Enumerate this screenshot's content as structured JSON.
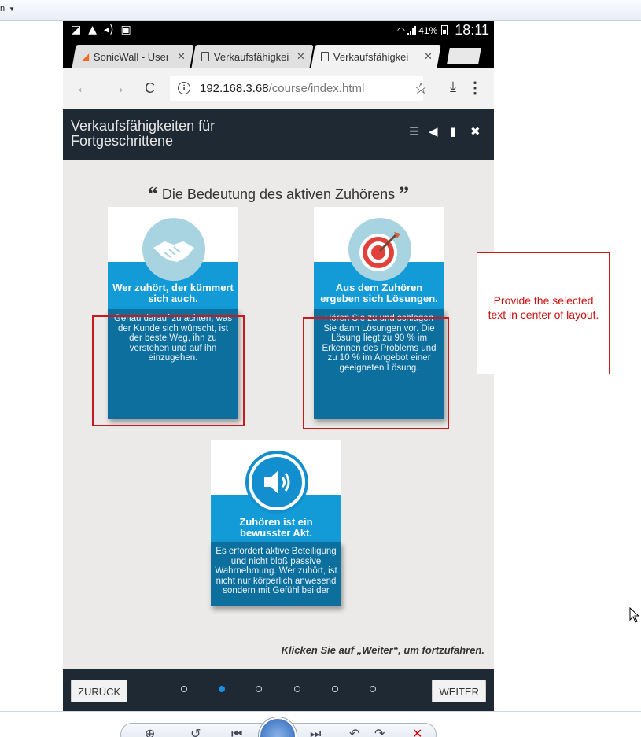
{
  "host": {
    "menu_label": "n",
    "menu_caret": "▼"
  },
  "statusbar": {
    "battery": "41%",
    "time": "18:11"
  },
  "tabs": [
    {
      "title": "SonicWall - User"
    },
    {
      "title": "Verkaufsfähigkei"
    },
    {
      "title": "Verkaufsfähigkei"
    }
  ],
  "addressbar": {
    "url_host": "192.168.3.68",
    "url_path": "/course/index.html"
  },
  "course": {
    "title": "Verkaufsfähigkeiten für Fortgeschrittene"
  },
  "slide": {
    "title": "Die Bedeutung des aktiven Zuhörens",
    "cards": [
      {
        "icon": "handshake-icon",
        "heading": "Wer zuhört, der kümmert sich auch.",
        "text": "Genau darauf zu achten, was der Kunde sich wünscht, ist der beste Weg, ihn zu verstehen und auf ihn einzugehen."
      },
      {
        "icon": "target-icon",
        "heading": "Aus dem Zuhören ergeben sich Lösungen.",
        "text": "Hören Sie zu und schlagen Sie dann Lösungen vor. Die Lösung liegt zu 90 % im Erkennen des Problems und zu 10 % im Angebot einer geeigneten Lösung."
      },
      {
        "icon": "speaker-icon",
        "heading": "Zuhören ist ein bewusster Akt.",
        "text": "Es erfordert aktive Beteiligung und nicht bloß passive Wahrnehmung. Wer zuhört, ist nicht nur körperlich anwesend sondern mit Gefühl bei der"
      }
    ],
    "continue_text": "Klicken Sie auf „Weiter“, um fortzufahren."
  },
  "footer": {
    "back_label": "ZURÜCK",
    "next_label": "WEITER",
    "pages": 6,
    "current_page": 2
  },
  "note": {
    "text": "Provide the selected text in center of layout."
  },
  "colors": {
    "header_bg": "#1f2933",
    "card_mid": "#139bd8",
    "card_body": "#0d6f9e",
    "selection": "#c8191f",
    "active_dot": "#1a8ee2"
  }
}
